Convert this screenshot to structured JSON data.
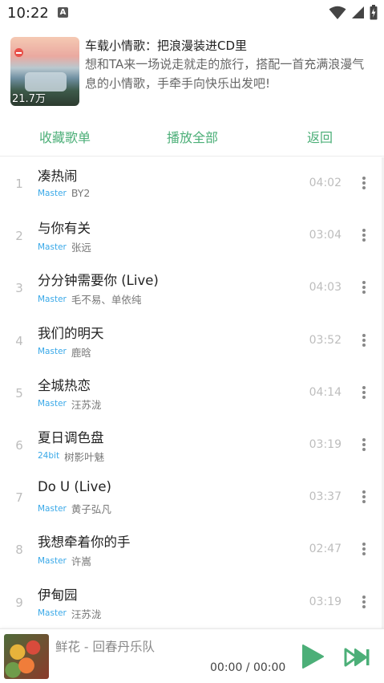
{
  "status_bar": {
    "time": "10:22",
    "notification_badge": "A",
    "icons": [
      "wifi-icon",
      "signal-icon",
      "battery-icon"
    ]
  },
  "playlist": {
    "title": "车载小情歌：把浪漫装进CD里",
    "description": "想和TA来一场说走就走的旅行，搭配一首充满浪漫气息的小情歌，手牵手向快乐出发吧!",
    "play_count": "21.7万"
  },
  "actions": {
    "collect_label": "收藏歌单",
    "play_all_label": "播放全部",
    "back_label": "返回"
  },
  "colors": {
    "accent_green": "#4caf78",
    "quality_blue": "#38a8e8"
  },
  "songs": [
    {
      "index": "1",
      "title": "凑热闹",
      "quality": "Master",
      "artist": "BY2",
      "duration": "04:02"
    },
    {
      "index": "2",
      "title": "与你有关",
      "quality": "Master",
      "artist": "张远",
      "duration": "03:04"
    },
    {
      "index": "3",
      "title": "分分钟需要你 (Live)",
      "quality": "Master",
      "artist": "毛不易、单依纯",
      "duration": "04:03"
    },
    {
      "index": "4",
      "title": "我们的明天",
      "quality": "Master",
      "artist": "鹿晗",
      "duration": "03:52"
    },
    {
      "index": "5",
      "title": "全城热恋",
      "quality": "Master",
      "artist": "汪苏泷",
      "duration": "04:14"
    },
    {
      "index": "6",
      "title": "夏日调色盘",
      "quality": "24bit",
      "artist": "树影叶魅",
      "duration": "03:19"
    },
    {
      "index": "7",
      "title": "Do U (Live)",
      "quality": "Master",
      "artist": "黄子弘凡",
      "duration": "03:37"
    },
    {
      "index": "8",
      "title": "我想牵着你的手",
      "quality": "Master",
      "artist": "许嵩",
      "duration": "02:47"
    },
    {
      "index": "9",
      "title": "伊甸园",
      "quality": "Master",
      "artist": "汪苏泷",
      "duration": "03:19"
    }
  ],
  "player": {
    "now_playing": "鲜花 - 回春丹乐队",
    "time": "00:00 / 00:00"
  }
}
